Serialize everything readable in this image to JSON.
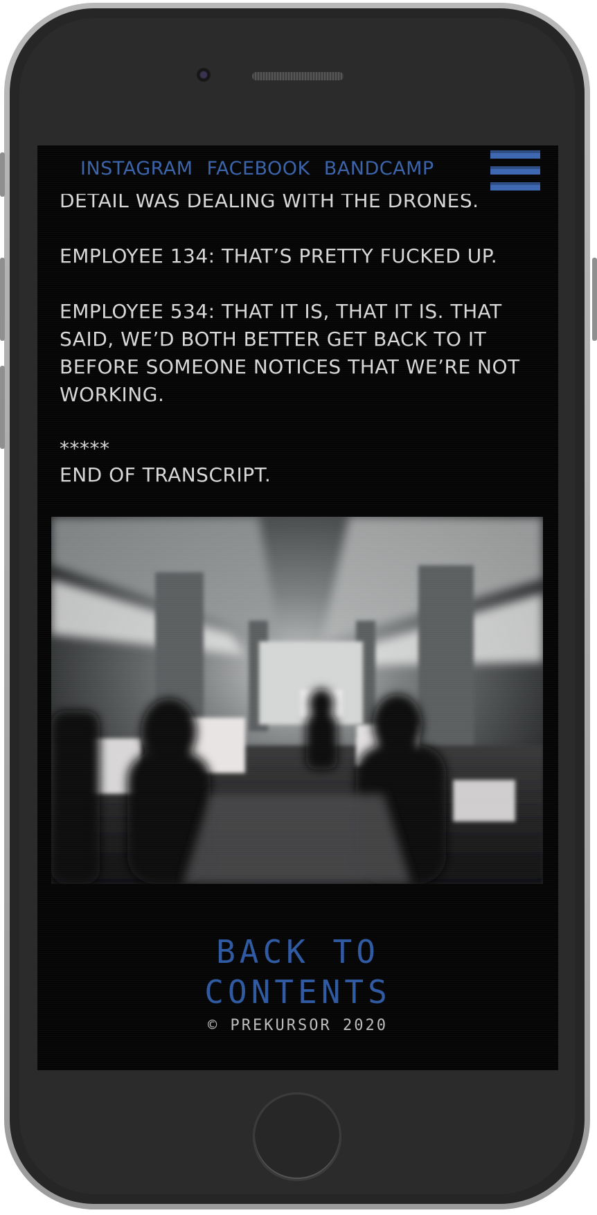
{
  "nav": {
    "links": [
      {
        "label": "INSTAGRAM"
      },
      {
        "label": "FACEBOOK"
      },
      {
        "label": "BANDCAMP"
      }
    ],
    "menu_icon": "hamburger-menu-icon"
  },
  "transcript": {
    "lines": [
      "DETAIL WAS DEALING WITH THE DRONES.",
      "EMPLOYEE 134: THAT’S PRETTY FUCKED UP.",
      "EMPLOYEE 534: THAT IT IS, THAT IT IS. THAT SAID, WE’D BOTH BETTER GET BACK TO IT BEFORE SOMEONE NOTICES THAT WE’RE NOT WORKING."
    ],
    "separator": "*****",
    "end": "END OF TRANSCRIPT."
  },
  "footer": {
    "back_link": "BACK TO CONTENTS",
    "copyright": "© PREKURSOR 2020"
  },
  "colors": {
    "accent": "#3a63a9",
    "background": "#050505",
    "text": "#d8d8d8"
  }
}
